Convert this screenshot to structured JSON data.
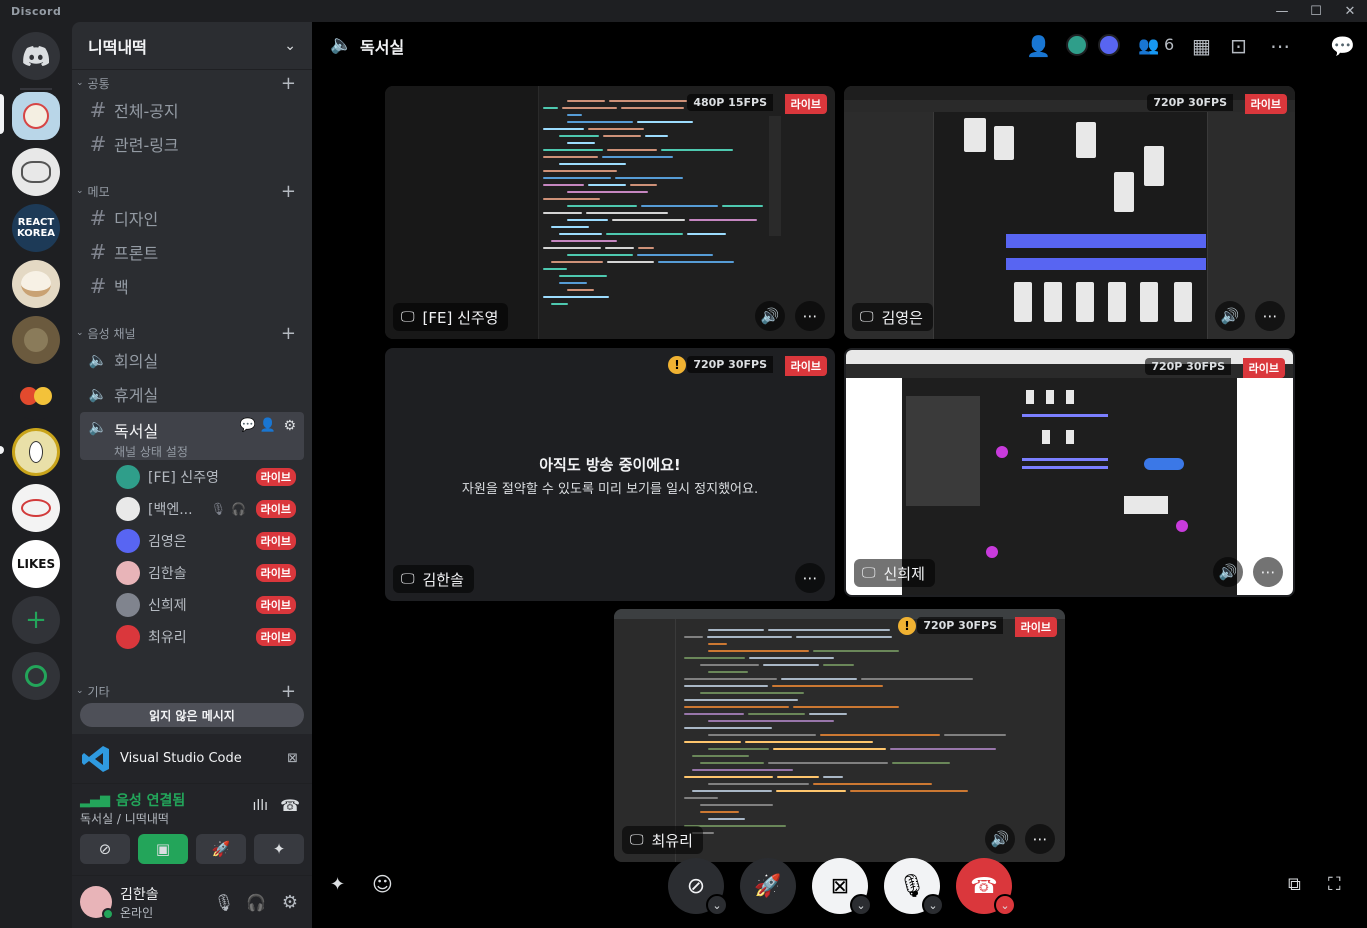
{
  "app": {
    "brand": "Discord"
  },
  "window": {
    "minimize": "—",
    "maximize": "☐",
    "close": "✕"
  },
  "servers": [
    {
      "name": "discord-home",
      "label": "",
      "color": "#313338"
    },
    {
      "name": "server-1",
      "label": "",
      "color": "#b9d6e8"
    },
    {
      "name": "server-2",
      "label": "",
      "color": "#e8e8e8"
    },
    {
      "name": "react-korea",
      "label": "REACT KOREA",
      "color": "#1d3a57"
    },
    {
      "name": "server-4",
      "label": "",
      "color": "#e4d9c4"
    },
    {
      "name": "server-5",
      "label": "",
      "color": "#6b5a3e"
    },
    {
      "name": "server-6",
      "label": "",
      "color": "#f3c23a"
    },
    {
      "name": "server-7",
      "label": "",
      "color": "#e9e0a8"
    },
    {
      "name": "server-8",
      "label": "",
      "color": "#f3f3f3"
    },
    {
      "name": "likes",
      "label": "LIKES",
      "color": "#ffffff"
    }
  ],
  "guild": {
    "name": "니떡내떡"
  },
  "categories": {
    "common": "공통",
    "memo": "메모",
    "voice": "음성 채널",
    "etc": "기타"
  },
  "channels": {
    "common": [
      "전체-공지",
      "관련-링크"
    ],
    "memo": [
      "디자인",
      "프론트",
      "백"
    ],
    "voice": [
      "회의실",
      "휴게실"
    ]
  },
  "active_voice": {
    "name": "독서실",
    "status": "채널 상태 설정"
  },
  "voice_users": [
    {
      "name": "[FE] 신주영",
      "live": "라이브",
      "color": "#2f9e8a"
    },
    {
      "name": "[백엔...",
      "live": "라이브",
      "color": "#e9e9e9"
    },
    {
      "name": "김영은",
      "live": "라이브",
      "color": "#5865f2"
    },
    {
      "name": "김한솔",
      "live": "라이브",
      "color": "#e8b4b8"
    },
    {
      "name": "신희제",
      "live": "라이브",
      "color": "#80848e"
    },
    {
      "name": "최유리",
      "live": "라이브",
      "color": "#da373c"
    }
  ],
  "unread_pill": "읽지 않은 메시지",
  "activity": {
    "app": "Visual Studio Code"
  },
  "voice_panel": {
    "status": "음성 연결됨",
    "location": "독서실 / 니떡내떡"
  },
  "user": {
    "name": "김한솔",
    "status": "온라인"
  },
  "topbar": {
    "channel": "독서실",
    "member_count": "6"
  },
  "streams": [
    {
      "name": "[FE] 신주영",
      "res": "480P 15FPS",
      "live": "라이브",
      "kind": "code"
    },
    {
      "name": "김영은",
      "res": "720P 30FPS",
      "live": "라이브",
      "kind": "figma"
    },
    {
      "name": "김한솔",
      "res": "720P 30FPS",
      "live": "라이브",
      "kind": "paused",
      "paused_title": "아직도 방송 중이에요!",
      "paused_body": "자원을 절약할 수 있도록 미리 보기를 일시 정지했어요."
    },
    {
      "name": "신희제",
      "res": "720P 30FPS",
      "live": "라이브",
      "kind": "figma2"
    },
    {
      "name": "최유리",
      "res": "720P 30FPS",
      "live": "라이브",
      "kind": "code2"
    }
  ],
  "colors": {
    "accent": "#5865f2",
    "live": "#da373c",
    "green": "#23a55a",
    "warn": "#f0b232"
  }
}
